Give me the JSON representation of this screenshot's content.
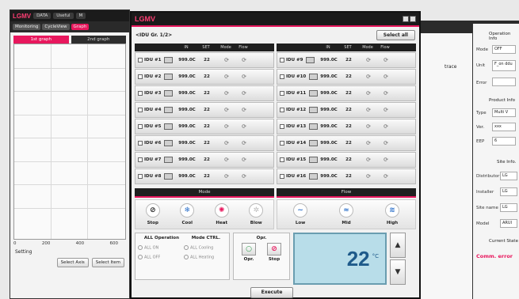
{
  "back_window": {
    "brand": "LGMV",
    "menus": [
      "DATA",
      "Useful",
      "M"
    ],
    "tabs": [
      "Monitoring",
      "CycleView",
      "Graph"
    ],
    "graph_tabs": [
      "1st graph",
      "2nd graph"
    ],
    "x_ticks": [
      "0",
      "200",
      "400",
      "600"
    ],
    "setting_label": "Setting",
    "select_axis": "Select Axis",
    "select_item": "Select Item"
  },
  "right_bg": {
    "trace_label": "trace"
  },
  "right_panel": {
    "operation_info": "Operation Info",
    "mode_label": "Mode",
    "mode_value": "OFF",
    "unit_label": "Unit",
    "unit_value": "F_on ddu",
    "error_label": "Error",
    "product_info": "Product Info",
    "type_label": "Type",
    "type_value": "Multi V",
    "ver_label": "Ver.",
    "ver_value": "xxx",
    "eep_label": "EEP",
    "eep_value": "6",
    "site_info": "Site Info.",
    "distributor_label": "Distributor",
    "distributor_value": "LG",
    "installer_label": "Installer",
    "installer_value": "LG",
    "site_name_label": "Site name",
    "site_name_value": "LG",
    "model_label": "Model",
    "model_value": "ARUI",
    "current_state": "Current State",
    "comm_error": "Comm. error"
  },
  "main": {
    "brand": "LGMV",
    "group_label": "<IDU Gr. 1/2>",
    "select_all": "Select all",
    "columns": [
      "IN",
      "SET",
      "Mode",
      "Flow"
    ],
    "left_units": [
      {
        "name": "IDU #1",
        "in": "999.0C",
        "set": "22"
      },
      {
        "name": "IDU #2",
        "in": "999.0C",
        "set": "22"
      },
      {
        "name": "IDU #3",
        "in": "999.0C",
        "set": "22"
      },
      {
        "name": "IDU #4",
        "in": "999.0C",
        "set": "22"
      },
      {
        "name": "IDU #5",
        "in": "999.0C",
        "set": "22"
      },
      {
        "name": "IDU #6",
        "in": "999.0C",
        "set": "22"
      },
      {
        "name": "IDU #7",
        "in": "999.0C",
        "set": "22"
      },
      {
        "name": "IDU #8",
        "in": "999.0C",
        "set": "22"
      }
    ],
    "right_units": [
      {
        "name": "IDU #9",
        "in": "999.0C",
        "set": "22"
      },
      {
        "name": "IDU #10",
        "in": "999.0C",
        "set": "22"
      },
      {
        "name": "IDU #11",
        "in": "999.0C",
        "set": "22"
      },
      {
        "name": "IDU #12",
        "in": "999.0C",
        "set": "22"
      },
      {
        "name": "IDU #13",
        "in": "999.0C",
        "set": "22"
      },
      {
        "name": "IDU #14",
        "in": "999.0C",
        "set": "22"
      },
      {
        "name": "IDU #15",
        "in": "999.0C",
        "set": "22"
      },
      {
        "name": "IDU #16",
        "in": "999.0C",
        "set": "22"
      }
    ],
    "mode_section": "Mode",
    "flow_section": "Flow",
    "mode_buttons": [
      "Stop",
      "Cool",
      "Heat",
      "Blow"
    ],
    "flow_buttons": [
      "Low",
      "Mid",
      "High"
    ],
    "all_operation": "ALL Operation",
    "mode_ctrl": "Mode CTRL.",
    "all_on": "ALL ON",
    "all_off": "ALL OFF",
    "all_cooling": "ALL Cooling",
    "all_heating": "ALL Heating",
    "opr_title": "Opr.",
    "opr_button": "Opr.",
    "stop_button": "Stop",
    "temperature": "22",
    "temp_unit": "°C",
    "execute": "Execute"
  }
}
